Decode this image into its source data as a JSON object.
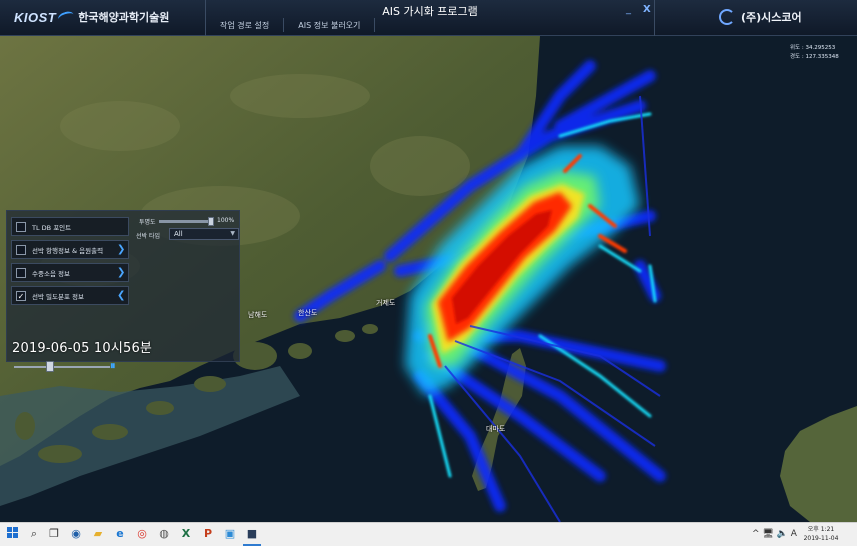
{
  "titlebar": {
    "brand": "KIOST",
    "org_name": "한국해양과학기술원",
    "app_title": "AIS 가시화 프로그램",
    "menu": [
      "작업 경로 설정",
      "AIS 정보 불러오기"
    ],
    "minimize": "_",
    "close": "X",
    "company": "(주)시스코어"
  },
  "map": {
    "coordinates": [
      "위도 : 34.295253",
      "경도 : 127.335348"
    ],
    "places": [
      "남해도",
      "한산도",
      "거제도",
      "대마도"
    ]
  },
  "panel": {
    "layers": [
      {
        "label": "TL DB 포인트",
        "checked": false,
        "chevron": ""
      },
      {
        "label": "선박 항행정보 & 음원출력",
        "checked": false,
        "chevron": "❯"
      },
      {
        "label": "수중소음 정보",
        "checked": false,
        "chevron": "❯"
      },
      {
        "label": "선박 밀도분포 정보",
        "checked": true,
        "chevron": "❮"
      }
    ],
    "opacity_label": "투명도",
    "opacity_value": "100%",
    "opacity_level": 1.0,
    "type_label": "선박 타입",
    "type_value": "All",
    "datetime": "2019-06-05 10시56분",
    "time_position": 0.38,
    "pause_icon": "⏸"
  },
  "taskbar": {
    "icons": [
      "windows-icon",
      "search-icon",
      "task-view-icon",
      "app-icon",
      "file-explorer-icon",
      "edge-icon",
      "chrome-icon",
      "app-icon",
      "excel-icon",
      "powerpoint-icon",
      "app-icon",
      "app-icon"
    ],
    "tray": "^ 🖥 🔈 A",
    "clock_time": "오후 1:21",
    "clock_date": "2019-11-04"
  },
  "colors": {
    "sea": "#0e1c2a",
    "land": "#5e6a3d",
    "density_low": "#0a2bff",
    "density_mid": "#19e3ff",
    "density_high": "#ff2a00",
    "accent": "#3fa6ff"
  }
}
